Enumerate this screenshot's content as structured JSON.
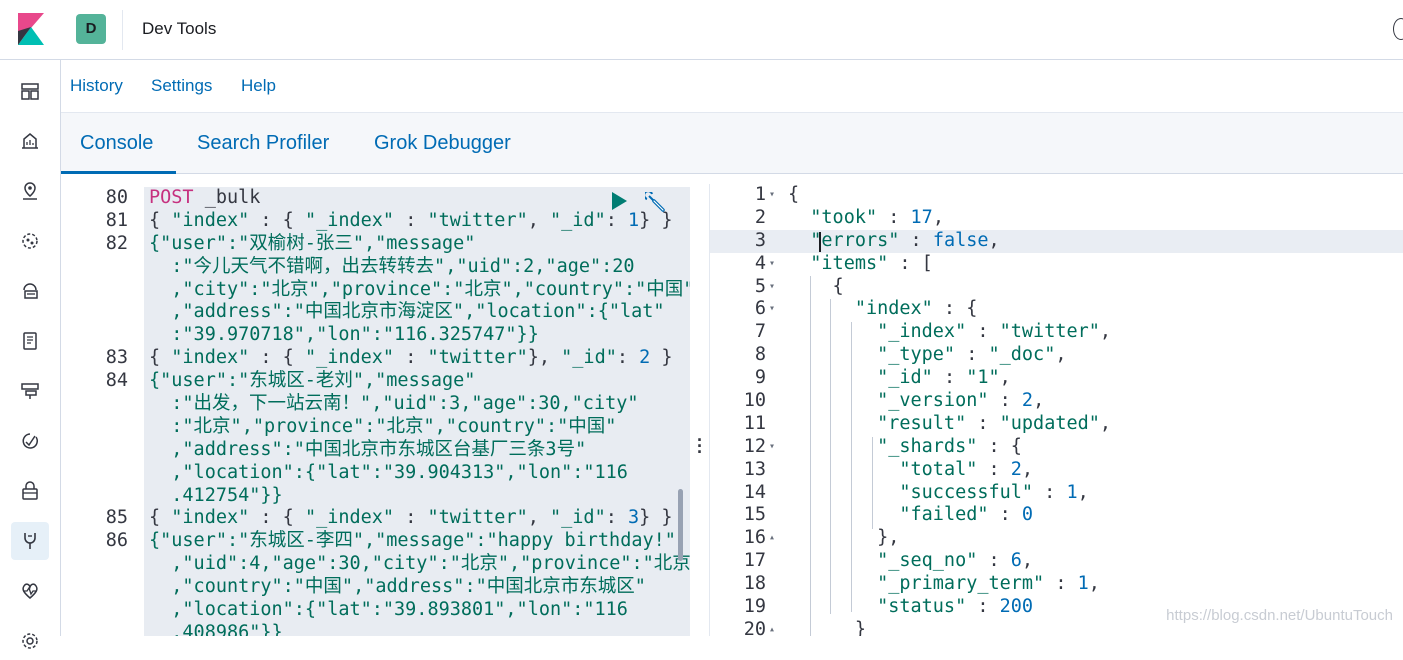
{
  "header": {
    "space_initial": "D",
    "app_title": "Dev Tools",
    "logo_colors": [
      "#e8488b",
      "#00bfb3",
      "#343741"
    ],
    "space_color": "#54b399"
  },
  "sidenav": {
    "items": [
      {
        "icon": "dashboard-icon"
      },
      {
        "icon": "canvas-icon"
      },
      {
        "icon": "maps-icon"
      },
      {
        "icon": "ml-icon"
      },
      {
        "icon": "infrastructure-icon"
      },
      {
        "icon": "logs-icon"
      },
      {
        "icon": "apm-icon"
      },
      {
        "icon": "uptime-icon"
      },
      {
        "icon": "siem-icon"
      },
      {
        "icon": "dev-tools-icon",
        "active": true
      },
      {
        "icon": "monitoring-icon"
      },
      {
        "icon": "management-icon"
      }
    ]
  },
  "menubar": {
    "history": "History",
    "settings": "Settings",
    "help": "Help"
  },
  "tabs": [
    {
      "label": "Console",
      "selected": true
    },
    {
      "label": "Search Profiler",
      "selected": false
    },
    {
      "label": "Grok Debugger",
      "selected": false
    }
  ],
  "editor": {
    "lines": [
      {
        "num": "80",
        "text": [
          {
            "c": "k-method",
            "t": "POST"
          },
          {
            "c": "k-url",
            "t": " _bulk"
          }
        ]
      },
      {
        "num": "81",
        "text": [
          {
            "c": "k-punc",
            "t": "{ "
          },
          {
            "c": "k-str",
            "t": "\"index\""
          },
          {
            "c": "k-punc",
            "t": " : { "
          },
          {
            "c": "k-str",
            "t": "\"_index\""
          },
          {
            "c": "k-punc",
            "t": " : "
          },
          {
            "c": "k-str",
            "t": "\"twitter\""
          },
          {
            "c": "k-punc",
            "t": ", "
          },
          {
            "c": "k-str",
            "t": "\"_id\""
          },
          {
            "c": "k-punc",
            "t": ": "
          },
          {
            "c": "k-num",
            "t": "1"
          },
          {
            "c": "k-punc",
            "t": "} }"
          }
        ]
      },
      {
        "num": "82",
        "text": [
          {
            "c": "k-str",
            "t": "{\"user\":\"双榆树-张三\",\"message\""
          }
        ]
      },
      {
        "num": "",
        "text": [
          {
            "c": "k-str",
            "t": "  :\"今儿天气不错啊，出去转转去\",\"uid\":2,\"age\":20"
          }
        ]
      },
      {
        "num": "",
        "text": [
          {
            "c": "k-str",
            "t": "  ,\"city\":\"北京\",\"province\":\"北京\",\"country\":\"中国\""
          }
        ]
      },
      {
        "num": "",
        "text": [
          {
            "c": "k-str",
            "t": "  ,\"address\":\"中国北京市海淀区\",\"location\":{\"lat\""
          }
        ]
      },
      {
        "num": "",
        "text": [
          {
            "c": "k-str",
            "t": "  :\"39.970718\",\"lon\":\"116.325747\"}}"
          }
        ]
      },
      {
        "num": "83",
        "text": [
          {
            "c": "k-punc",
            "t": "{ "
          },
          {
            "c": "k-str",
            "t": "\"index\""
          },
          {
            "c": "k-punc",
            "t": " : { "
          },
          {
            "c": "k-str",
            "t": "\"_index\""
          },
          {
            "c": "k-punc",
            "t": " : "
          },
          {
            "c": "k-str",
            "t": "\"twitter\""
          },
          {
            "c": "k-punc",
            "t": "}, "
          },
          {
            "c": "k-str",
            "t": "\"_id\""
          },
          {
            "c": "k-punc",
            "t": ": "
          },
          {
            "c": "k-num",
            "t": "2"
          },
          {
            "c": "k-punc",
            "t": " }"
          }
        ]
      },
      {
        "num": "84",
        "text": [
          {
            "c": "k-str",
            "t": "{\"user\":\"东城区-老刘\",\"message\""
          }
        ]
      },
      {
        "num": "",
        "text": [
          {
            "c": "k-str",
            "t": "  :\"出发，下一站云南！\",\"uid\":3,\"age\":30,\"city\""
          }
        ]
      },
      {
        "num": "",
        "text": [
          {
            "c": "k-str",
            "t": "  :\"北京\",\"province\":\"北京\",\"country\":\"中国\""
          }
        ]
      },
      {
        "num": "",
        "text": [
          {
            "c": "k-str",
            "t": "  ,\"address\":\"中国北京市东城区台基厂三条3号\""
          }
        ]
      },
      {
        "num": "",
        "text": [
          {
            "c": "k-str",
            "t": "  ,\"location\":{\"lat\":\"39.904313\",\"lon\":\"116"
          }
        ]
      },
      {
        "num": "",
        "text": [
          {
            "c": "k-str",
            "t": "  .412754\"}}"
          }
        ]
      },
      {
        "num": "85",
        "text": [
          {
            "c": "k-punc",
            "t": "{ "
          },
          {
            "c": "k-str",
            "t": "\"index\""
          },
          {
            "c": "k-punc",
            "t": " : { "
          },
          {
            "c": "k-str",
            "t": "\"_index\""
          },
          {
            "c": "k-punc",
            "t": " : "
          },
          {
            "c": "k-str",
            "t": "\"twitter\""
          },
          {
            "c": "k-punc",
            "t": ", "
          },
          {
            "c": "k-str",
            "t": "\"_id\""
          },
          {
            "c": "k-punc",
            "t": ": "
          },
          {
            "c": "k-num",
            "t": "3"
          },
          {
            "c": "k-punc",
            "t": "} }"
          }
        ]
      },
      {
        "num": "86",
        "text": [
          {
            "c": "k-str",
            "t": "{\"user\":\"东城区-李四\",\"message\":\"happy birthday!\""
          }
        ]
      },
      {
        "num": "",
        "text": [
          {
            "c": "k-str",
            "t": "  ,\"uid\":4,\"age\":30,\"city\":\"北京\",\"province\":\"北京\""
          }
        ]
      },
      {
        "num": "",
        "text": [
          {
            "c": "k-str",
            "t": "  ,\"country\":\"中国\",\"address\":\"中国北京市东城区\""
          }
        ]
      },
      {
        "num": "",
        "text": [
          {
            "c": "k-str",
            "t": "  ,\"location\":{\"lat\":\"39.893801\",\"lon\":\"116"
          }
        ]
      },
      {
        "num": "",
        "text": [
          {
            "c": "k-str",
            "t": "  .408986\"}}"
          }
        ]
      }
    ]
  },
  "output": {
    "lines": [
      {
        "num": "1",
        "fold": "▾",
        "text": [
          {
            "c": "k-punc",
            "t": "{"
          }
        ]
      },
      {
        "num": "2",
        "fold": "",
        "text": [
          {
            "c": "k-punc",
            "t": "  "
          },
          {
            "c": "o-key",
            "t": "\"took\""
          },
          {
            "c": "k-punc",
            "t": " : "
          },
          {
            "c": "o-num",
            "t": "17"
          },
          {
            "c": "k-punc",
            "t": ","
          }
        ]
      },
      {
        "num": "3",
        "fold": "",
        "hl": true,
        "text": [
          {
            "c": "k-punc",
            "t": "  "
          },
          {
            "c": "o-key",
            "t": "\"errors\""
          },
          {
            "c": "k-punc",
            "t": " : "
          },
          {
            "c": "o-bool",
            "t": "false"
          },
          {
            "c": "k-punc",
            "t": ","
          }
        ]
      },
      {
        "num": "4",
        "fold": "▾",
        "text": [
          {
            "c": "k-punc",
            "t": "  "
          },
          {
            "c": "o-key",
            "t": "\"items\""
          },
          {
            "c": "k-punc",
            "t": " : ["
          }
        ]
      },
      {
        "num": "5",
        "fold": "▾",
        "text": [
          {
            "c": "k-punc",
            "t": "    {"
          }
        ]
      },
      {
        "num": "6",
        "fold": "▾",
        "text": [
          {
            "c": "k-punc",
            "t": "      "
          },
          {
            "c": "o-key",
            "t": "\"index\""
          },
          {
            "c": "k-punc",
            "t": " : {"
          }
        ]
      },
      {
        "num": "7",
        "fold": "",
        "text": [
          {
            "c": "k-punc",
            "t": "        "
          },
          {
            "c": "o-key",
            "t": "\"_index\""
          },
          {
            "c": "k-punc",
            "t": " : "
          },
          {
            "c": "o-str",
            "t": "\"twitter\""
          },
          {
            "c": "k-punc",
            "t": ","
          }
        ]
      },
      {
        "num": "8",
        "fold": "",
        "text": [
          {
            "c": "k-punc",
            "t": "        "
          },
          {
            "c": "o-key",
            "t": "\"_type\""
          },
          {
            "c": "k-punc",
            "t": " : "
          },
          {
            "c": "o-str",
            "t": "\"_doc\""
          },
          {
            "c": "k-punc",
            "t": ","
          }
        ]
      },
      {
        "num": "9",
        "fold": "",
        "text": [
          {
            "c": "k-punc",
            "t": "        "
          },
          {
            "c": "o-key",
            "t": "\"_id\""
          },
          {
            "c": "k-punc",
            "t": " : "
          },
          {
            "c": "o-str",
            "t": "\"1\""
          },
          {
            "c": "k-punc",
            "t": ","
          }
        ]
      },
      {
        "num": "10",
        "fold": "",
        "text": [
          {
            "c": "k-punc",
            "t": "        "
          },
          {
            "c": "o-key",
            "t": "\"_version\""
          },
          {
            "c": "k-punc",
            "t": " : "
          },
          {
            "c": "o-num",
            "t": "2"
          },
          {
            "c": "k-punc",
            "t": ","
          }
        ]
      },
      {
        "num": "11",
        "fold": "",
        "text": [
          {
            "c": "k-punc",
            "t": "        "
          },
          {
            "c": "o-key",
            "t": "\"result\""
          },
          {
            "c": "k-punc",
            "t": " : "
          },
          {
            "c": "o-str",
            "t": "\"updated\""
          },
          {
            "c": "k-punc",
            "t": ","
          }
        ]
      },
      {
        "num": "12",
        "fold": "▾",
        "text": [
          {
            "c": "k-punc",
            "t": "        "
          },
          {
            "c": "o-key",
            "t": "\"_shards\""
          },
          {
            "c": "k-punc",
            "t": " : {"
          }
        ]
      },
      {
        "num": "13",
        "fold": "",
        "text": [
          {
            "c": "k-punc",
            "t": "          "
          },
          {
            "c": "o-key",
            "t": "\"total\""
          },
          {
            "c": "k-punc",
            "t": " : "
          },
          {
            "c": "o-num",
            "t": "2"
          },
          {
            "c": "k-punc",
            "t": ","
          }
        ]
      },
      {
        "num": "14",
        "fold": "",
        "text": [
          {
            "c": "k-punc",
            "t": "          "
          },
          {
            "c": "o-key",
            "t": "\"successful\""
          },
          {
            "c": "k-punc",
            "t": " : "
          },
          {
            "c": "o-num",
            "t": "1"
          },
          {
            "c": "k-punc",
            "t": ","
          }
        ]
      },
      {
        "num": "15",
        "fold": "",
        "text": [
          {
            "c": "k-punc",
            "t": "          "
          },
          {
            "c": "o-key",
            "t": "\"failed\""
          },
          {
            "c": "k-punc",
            "t": " : "
          },
          {
            "c": "o-num",
            "t": "0"
          }
        ]
      },
      {
        "num": "16",
        "fold": "▴",
        "text": [
          {
            "c": "k-punc",
            "t": "        },"
          }
        ]
      },
      {
        "num": "17",
        "fold": "",
        "text": [
          {
            "c": "k-punc",
            "t": "        "
          },
          {
            "c": "o-key",
            "t": "\"_seq_no\""
          },
          {
            "c": "k-punc",
            "t": " : "
          },
          {
            "c": "o-num",
            "t": "6"
          },
          {
            "c": "k-punc",
            "t": ","
          }
        ]
      },
      {
        "num": "18",
        "fold": "",
        "text": [
          {
            "c": "k-punc",
            "t": "        "
          },
          {
            "c": "o-key",
            "t": "\"_primary_term\""
          },
          {
            "c": "k-punc",
            "t": " : "
          },
          {
            "c": "o-num",
            "t": "1"
          },
          {
            "c": "k-punc",
            "t": ","
          }
        ]
      },
      {
        "num": "19",
        "fold": "",
        "text": [
          {
            "c": "k-punc",
            "t": "        "
          },
          {
            "c": "o-key",
            "t": "\"status\""
          },
          {
            "c": "k-punc",
            "t": " : "
          },
          {
            "c": "o-num",
            "t": "200"
          }
        ]
      },
      {
        "num": "20",
        "fold": "▴",
        "text": [
          {
            "c": "k-punc",
            "t": "      }"
          }
        ]
      }
    ]
  },
  "watermark": "https://blog.csdn.net/UbuntuTouch"
}
